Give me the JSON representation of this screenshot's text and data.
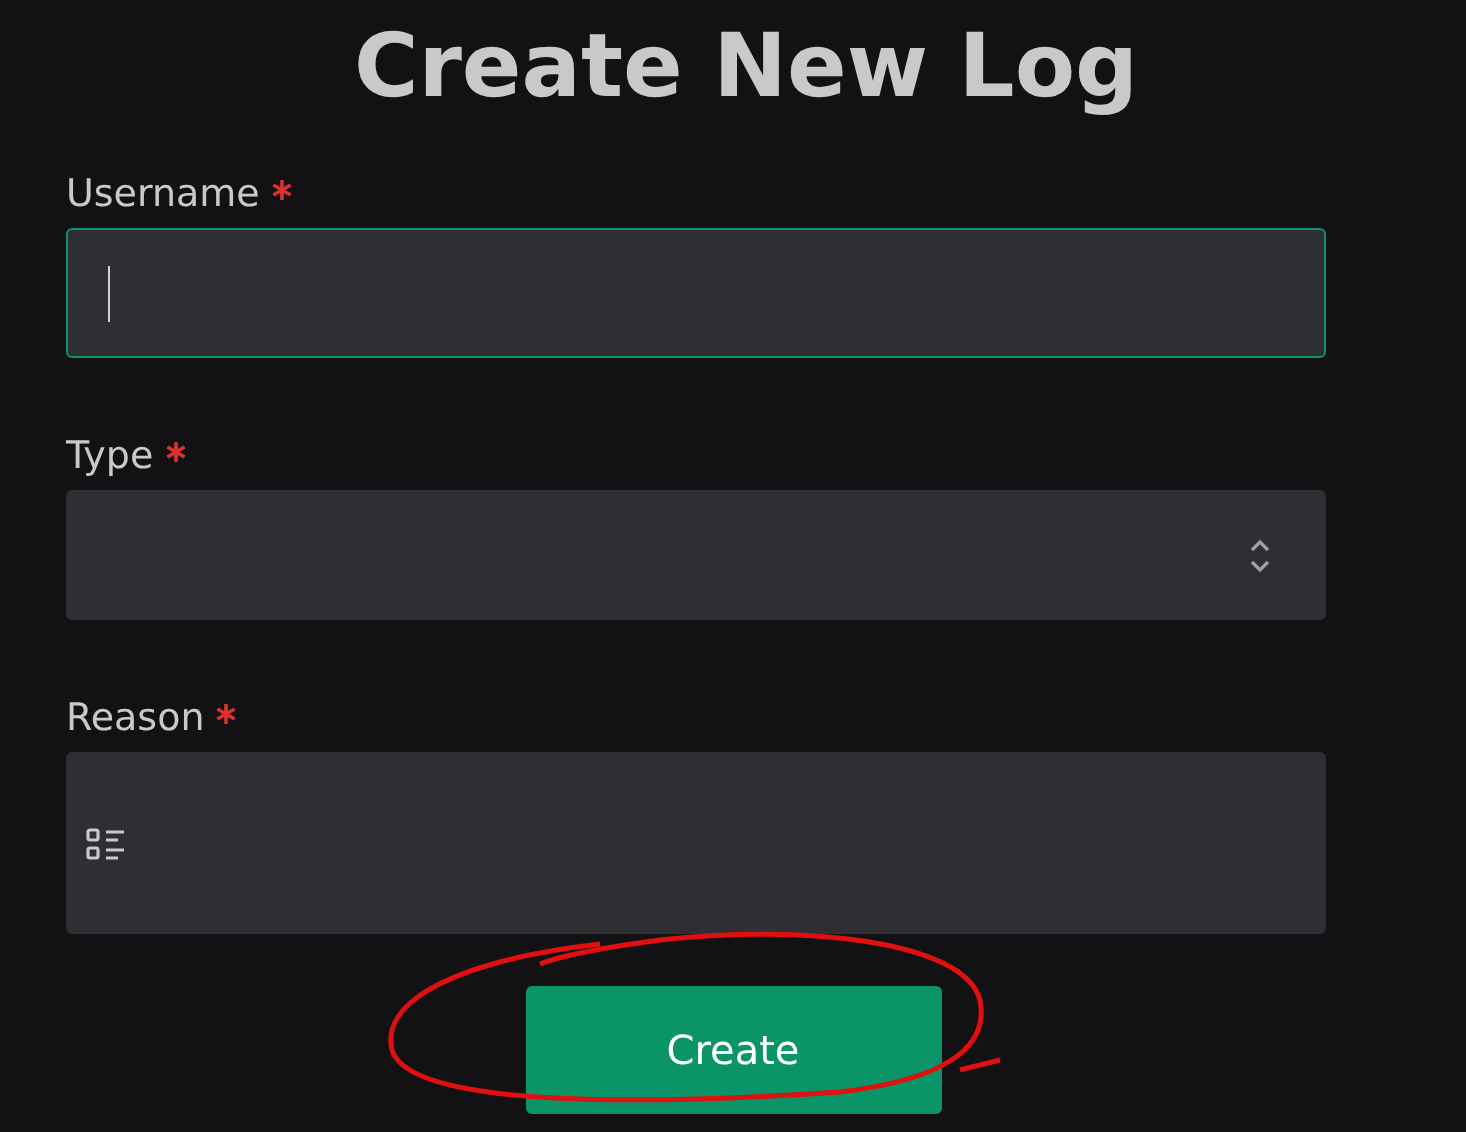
{
  "title": "Create New Log",
  "fields": [
    {
      "kind": "text",
      "label": "Username",
      "required": true,
      "focused": true
    },
    {
      "kind": "select",
      "label": "Type",
      "required": true,
      "focused": false
    },
    {
      "kind": "textarea",
      "label": "Reason",
      "required": true,
      "focused": false
    }
  ],
  "submit_button": {
    "label": "Create"
  }
}
